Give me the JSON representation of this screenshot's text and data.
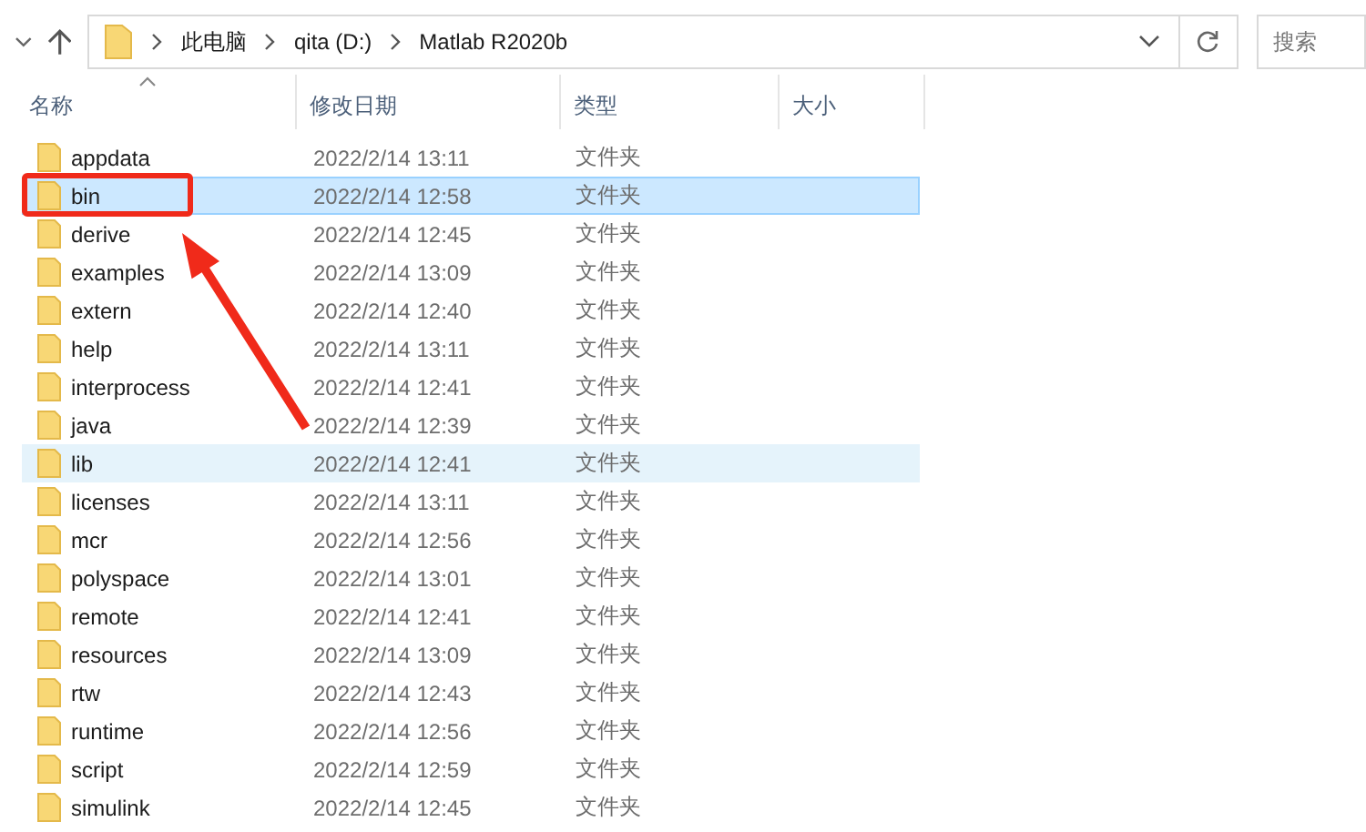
{
  "address_bar": {
    "crumbs": [
      "此电脑",
      "qita (D:)",
      "Matlab R2020b"
    ]
  },
  "search": {
    "placeholder": "搜索"
  },
  "columns": [
    {
      "label": "名称",
      "sorted": true
    },
    {
      "label": "修改日期",
      "sorted": false
    },
    {
      "label": "类型",
      "sorted": false
    },
    {
      "label": "大小",
      "sorted": false
    }
  ],
  "rows": [
    {
      "name": "appdata",
      "date": "2022/2/14 13:11",
      "type": "文件夹",
      "selected": false,
      "hovered": false
    },
    {
      "name": "bin",
      "date": "2022/2/14 12:58",
      "type": "文件夹",
      "selected": true,
      "hovered": false
    },
    {
      "name": "derive",
      "date": "2022/2/14 12:45",
      "type": "文件夹",
      "selected": false,
      "hovered": false
    },
    {
      "name": "examples",
      "date": "2022/2/14 13:09",
      "type": "文件夹",
      "selected": false,
      "hovered": false
    },
    {
      "name": "extern",
      "date": "2022/2/14 12:40",
      "type": "文件夹",
      "selected": false,
      "hovered": false
    },
    {
      "name": "help",
      "date": "2022/2/14 13:11",
      "type": "文件夹",
      "selected": false,
      "hovered": false
    },
    {
      "name": "interprocess",
      "date": "2022/2/14 12:41",
      "type": "文件夹",
      "selected": false,
      "hovered": false
    },
    {
      "name": "java",
      "date": "2022/2/14 12:39",
      "type": "文件夹",
      "selected": false,
      "hovered": false
    },
    {
      "name": "lib",
      "date": "2022/2/14 12:41",
      "type": "文件夹",
      "selected": false,
      "hovered": true
    },
    {
      "name": "licenses",
      "date": "2022/2/14 13:11",
      "type": "文件夹",
      "selected": false,
      "hovered": false
    },
    {
      "name": "mcr",
      "date": "2022/2/14 12:56",
      "type": "文件夹",
      "selected": false,
      "hovered": false
    },
    {
      "name": "polyspace",
      "date": "2022/2/14 13:01",
      "type": "文件夹",
      "selected": false,
      "hovered": false
    },
    {
      "name": "remote",
      "date": "2022/2/14 12:41",
      "type": "文件夹",
      "selected": false,
      "hovered": false
    },
    {
      "name": "resources",
      "date": "2022/2/14 13:09",
      "type": "文件夹",
      "selected": false,
      "hovered": false
    },
    {
      "name": "rtw",
      "date": "2022/2/14 12:43",
      "type": "文件夹",
      "selected": false,
      "hovered": false
    },
    {
      "name": "runtime",
      "date": "2022/2/14 12:56",
      "type": "文件夹",
      "selected": false,
      "hovered": false
    },
    {
      "name": "script",
      "date": "2022/2/14 12:59",
      "type": "文件夹",
      "selected": false,
      "hovered": false
    },
    {
      "name": "simulink",
      "date": "2022/2/14 12:45",
      "type": "文件夹",
      "selected": false,
      "hovered": false
    }
  ]
}
